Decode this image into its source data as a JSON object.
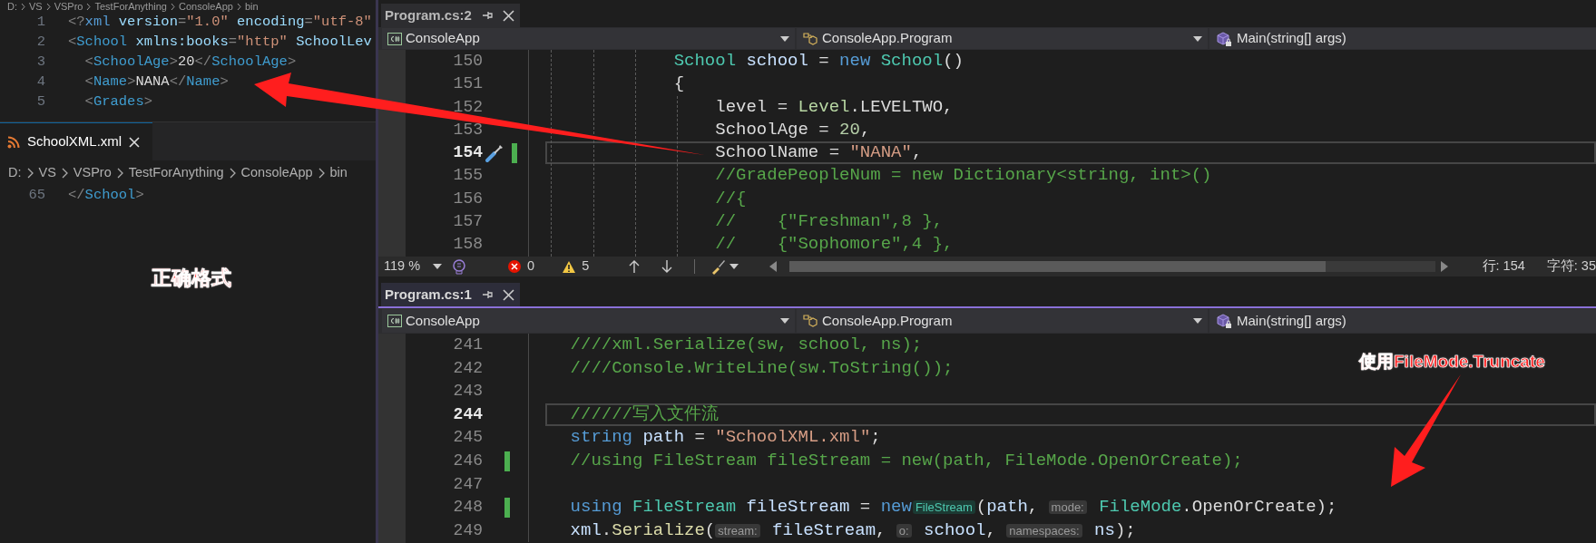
{
  "xml_editor": {
    "path_top": [
      "D:",
      "VS",
      "VSPro",
      "TestForAnything",
      "ConsoleApp",
      "bin"
    ],
    "lines": [
      {
        "number": "1",
        "tokens": [
          {
            "kind": "xpunct",
            "text": "<?"
          },
          {
            "kind": "keyword",
            "text": "xml"
          },
          {
            "kind": "attr",
            "text": " version"
          },
          {
            "kind": "xpunct",
            "text": "="
          },
          {
            "kind": "xstring",
            "text": "\"1.0\""
          },
          {
            "kind": "attr",
            "text": " encoding"
          },
          {
            "kind": "xpunct",
            "text": "="
          },
          {
            "kind": "xstring",
            "text": "\"utf-8\""
          }
        ]
      },
      {
        "number": "2",
        "tokens": [
          {
            "kind": "xpunct",
            "text": "<"
          },
          {
            "kind": "tag",
            "text": "School"
          },
          {
            "kind": "attr",
            "text": " xmlns:books"
          },
          {
            "kind": "xpunct",
            "text": "="
          },
          {
            "kind": "xstring",
            "text": "\"http\""
          },
          {
            "kind": "attr",
            "text": " SchoolLev"
          }
        ]
      },
      {
        "number": "3",
        "tokens": [
          {
            "kind": "xpunct",
            "text": "  <"
          },
          {
            "kind": "tag",
            "text": "SchoolAge"
          },
          {
            "kind": "xpunct",
            "text": ">"
          },
          {
            "kind": "plain",
            "text": "20"
          },
          {
            "kind": "xpunct",
            "text": "</"
          },
          {
            "kind": "tag",
            "text": "SchoolAge"
          },
          {
            "kind": "xpunct",
            "text": ">"
          }
        ]
      },
      {
        "number": "4",
        "tokens": [
          {
            "kind": "xpunct",
            "text": "  <"
          },
          {
            "kind": "tag",
            "text": "Name"
          },
          {
            "kind": "xpunct",
            "text": ">"
          },
          {
            "kind": "plain",
            "text": "NANA"
          },
          {
            "kind": "xpunct",
            "text": "</"
          },
          {
            "kind": "tag",
            "text": "Name"
          },
          {
            "kind": "xpunct",
            "text": ">"
          }
        ]
      },
      {
        "number": "5",
        "tokens": [
          {
            "kind": "xpunct",
            "text": "  <"
          },
          {
            "kind": "tag",
            "text": "Grades"
          },
          {
            "kind": "xpunct",
            "text": ">"
          }
        ]
      }
    ],
    "tab": {
      "title": "SchoolXML.xml",
      "selected": true
    },
    "breadcrumb": [
      "D:",
      "VS",
      "VSPro",
      "TestForAnything",
      "ConsoleApp",
      "bin"
    ],
    "lines_below": [
      {
        "number": "65",
        "tokens": [
          {
            "kind": "xpunct",
            "text": "</"
          },
          {
            "kind": "tag",
            "text": "School"
          },
          {
            "kind": "xpunct",
            "text": ">"
          }
        ]
      }
    ]
  },
  "top_editor": {
    "tab": {
      "title": "Program.cs:2",
      "selected": false
    },
    "nav": [
      "ConsoleApp",
      "ConsoleApp.Program",
      "Main(string[] args)"
    ],
    "lines": [
      {
        "number": "150",
        "current": false,
        "changed": false,
        "quick_action": false,
        "tokens": [
          {
            "kind": "type",
            "text": "              School"
          },
          {
            "kind": "ident",
            "text": " school"
          },
          {
            "kind": "plain",
            "text": " = "
          },
          {
            "kind": "keyword",
            "text": "new"
          },
          {
            "kind": "type",
            "text": " School"
          },
          {
            "kind": "plain",
            "text": "()"
          }
        ]
      },
      {
        "number": "151",
        "current": false,
        "changed": false,
        "quick_action": false,
        "tokens": [
          {
            "kind": "plain",
            "text": "              {"
          }
        ]
      },
      {
        "number": "152",
        "current": false,
        "changed": false,
        "quick_action": false,
        "tokens": [
          {
            "kind": "plain",
            "text": "                  level = "
          },
          {
            "kind": "enum",
            "text": "Level"
          },
          {
            "kind": "plain",
            "text": ".LEVELTWO,"
          }
        ]
      },
      {
        "number": "153",
        "current": false,
        "changed": false,
        "quick_action": false,
        "tokens": [
          {
            "kind": "plain",
            "text": "                  SchoolAge = "
          },
          {
            "kind": "number",
            "text": "20"
          },
          {
            "kind": "plain",
            "text": ","
          }
        ]
      },
      {
        "number": "154",
        "current": true,
        "changed": true,
        "quick_action": true,
        "tokens": [
          {
            "kind": "plain",
            "text": "                  SchoolName = "
          },
          {
            "kind": "string",
            "text": "\"NANA\""
          },
          {
            "kind": "plain",
            "text": ","
          }
        ]
      },
      {
        "number": "155",
        "current": false,
        "changed": false,
        "quick_action": false,
        "tokens": [
          {
            "kind": "comment",
            "text": "                  //GradePeopleNum = new Dictionary<string, int>()"
          }
        ]
      },
      {
        "number": "156",
        "current": false,
        "changed": false,
        "quick_action": false,
        "tokens": [
          {
            "kind": "comment",
            "text": "                  //{"
          }
        ]
      },
      {
        "number": "157",
        "current": false,
        "changed": false,
        "quick_action": false,
        "tokens": [
          {
            "kind": "comment",
            "text": "                  //    {\"Freshman\",8 },"
          }
        ]
      },
      {
        "number": "158",
        "current": false,
        "changed": false,
        "quick_action": false,
        "tokens": [
          {
            "kind": "comment",
            "text": "                  //    {\"Sophomore\",4 },"
          }
        ]
      }
    ],
    "status": {
      "zoom": "119 %",
      "errors": "0",
      "warnings": "5",
      "line": "行: 154",
      "column": "字符: 35"
    }
  },
  "bottom_editor": {
    "tab": {
      "title": "Program.cs:1",
      "selected": true
    },
    "nav": [
      "ConsoleApp",
      "ConsoleApp.Program",
      "Main(string[] args)"
    ],
    "lines": [
      {
        "number": "241",
        "current": false,
        "changed": false,
        "tokens": [
          {
            "kind": "comment",
            "text": "    ////xml.Serialize(sw, school, ns);"
          }
        ]
      },
      {
        "number": "242",
        "current": false,
        "changed": false,
        "tokens": [
          {
            "kind": "comment",
            "text": "    ////Console.WriteLine(sw.ToString());"
          }
        ]
      },
      {
        "number": "243",
        "current": false,
        "changed": false
      },
      {
        "number": "244",
        "current": true,
        "changed": false,
        "tokens": [
          {
            "kind": "comment",
            "text": "    //////写入文件流"
          }
        ]
      },
      {
        "number": "245",
        "current": false,
        "changed": false,
        "tokens": [
          {
            "kind": "keyword",
            "text": "    string"
          },
          {
            "kind": "ident",
            "text": " path"
          },
          {
            "kind": "plain",
            "text": " = "
          },
          {
            "kind": "string",
            "text": "\"SchoolXML.xml\""
          },
          {
            "kind": "plain",
            "text": ";"
          }
        ]
      },
      {
        "number": "246",
        "current": false,
        "changed": true,
        "tokens": [
          {
            "kind": "comment",
            "text": "    //using FileStream fileStream = new(path, FileMode.OpenOrCreate);"
          }
        ]
      },
      {
        "number": "247",
        "current": false,
        "changed": false
      },
      {
        "number": "248",
        "current": false,
        "changed": true,
        "tokens": [
          {
            "kind": "keyword",
            "text": "    using"
          },
          {
            "kind": "type",
            "text": " FileStream"
          },
          {
            "kind": "ident",
            "text": " fileStream"
          },
          {
            "kind": "plain",
            "text": " = "
          },
          {
            "kind": "keyword",
            "text": "new"
          },
          {
            "kind": "typehint",
            "text": "FileStream"
          },
          {
            "kind": "plain",
            "text": "("
          },
          {
            "kind": "ident",
            "text": "path"
          },
          {
            "kind": "plain",
            "text": ", "
          },
          {
            "kind": "hint",
            "text": "mode:"
          },
          {
            "kind": "type",
            "text": " FileMode"
          },
          {
            "kind": "plain",
            "text": ".OpenOrCreate);"
          }
        ]
      },
      {
        "number": "249",
        "current": false,
        "changed": false,
        "tokens": [
          {
            "kind": "ident",
            "text": "    xml"
          },
          {
            "kind": "plain",
            "text": "."
          },
          {
            "kind": "method",
            "text": "Serialize"
          },
          {
            "kind": "plain",
            "text": "("
          },
          {
            "kind": "hint",
            "text": "stream:"
          },
          {
            "kind": "ident",
            "text": " fileStream"
          },
          {
            "kind": "plain",
            "text": ", "
          },
          {
            "kind": "hint",
            "text": "o:"
          },
          {
            "kind": "ident",
            "text": " school"
          },
          {
            "kind": "plain",
            "text": ", "
          },
          {
            "kind": "hint",
            "text": "namespaces:"
          },
          {
            "kind": "ident",
            "text": " ns"
          },
          {
            "kind": "plain",
            "text": ");"
          }
        ]
      }
    ]
  },
  "annotations": [
    {
      "text": "正确格式"
    },
    {
      "text": "使用FileMode.Truncate"
    }
  ]
}
